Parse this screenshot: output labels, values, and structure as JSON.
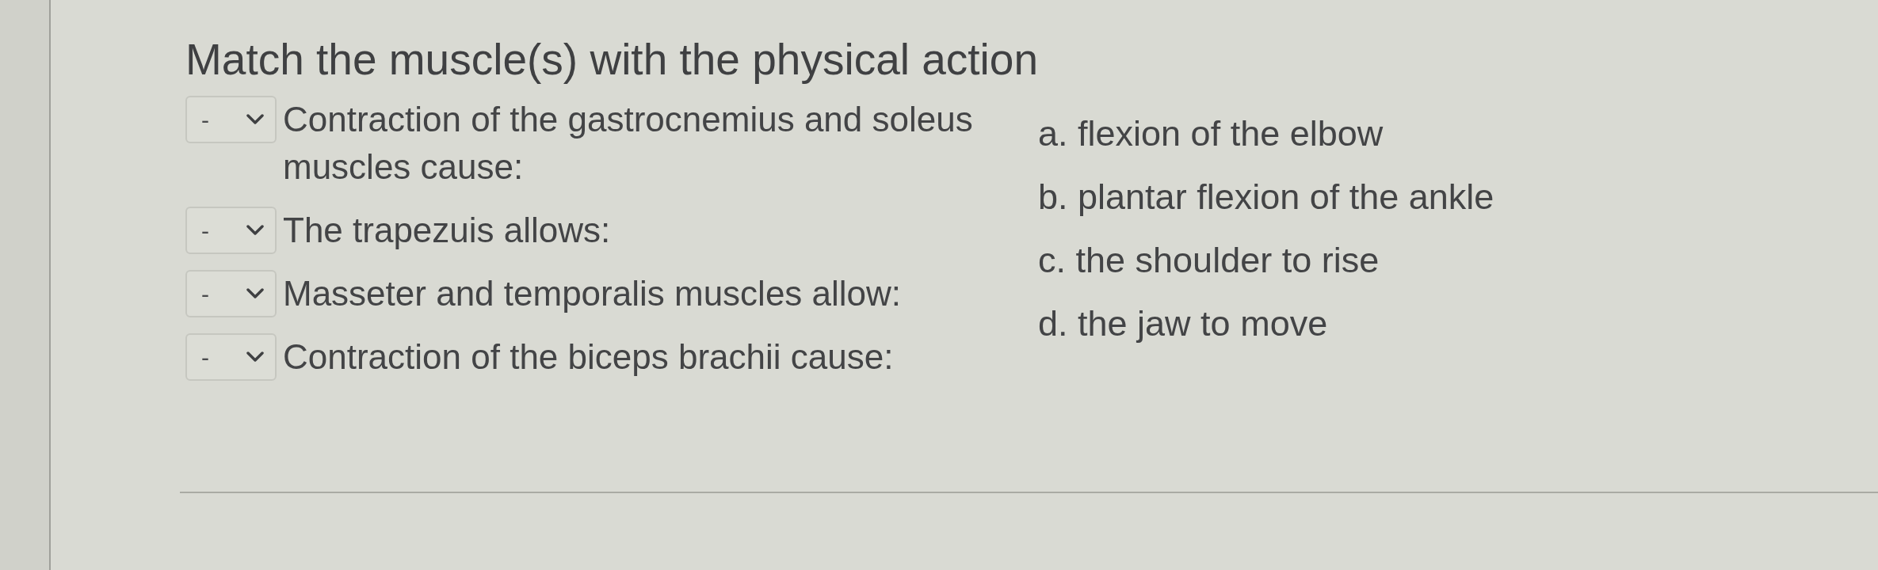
{
  "title": "Match the muscle(s) with the physical action",
  "questions": [
    {
      "value": "-",
      "prompt": "Contraction of the gastrocnemius and soleus muscles cause:"
    },
    {
      "value": "-",
      "prompt": "The trapezuis allows:"
    },
    {
      "value": "-",
      "prompt": "Masseter and temporalis muscles allow:"
    },
    {
      "value": "-",
      "prompt": "Contraction of the biceps brachii cause:"
    }
  ],
  "choices": [
    "a. flexion of the elbow",
    "b. plantar flexion of the ankle",
    "c. the shoulder to rise",
    "d. the jaw to move"
  ]
}
